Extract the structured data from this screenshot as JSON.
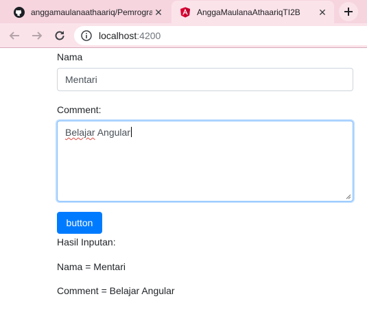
{
  "browser": {
    "tabs": [
      {
        "title": "anggamaulanaathaariq/Pemrogra",
        "icon": "github-icon",
        "active": false
      },
      {
        "title": "AnggaMaulanaAthaariqTI2B",
        "icon": "angular-icon",
        "active": true
      }
    ],
    "close_glyph": "✕",
    "new_tab_glyph": "+",
    "address": {
      "host": "localhost",
      "port": ":4200"
    },
    "colors": {
      "tab_strip": "#f6d5df",
      "toolbar": "#fbe3ea"
    }
  },
  "form": {
    "name_label": "Nama",
    "name_value": "Mentari",
    "comment_label": "Comment:",
    "comment_word1": "Belajar",
    "comment_word2": " Angular",
    "button_label": "button",
    "button_color": "#007bff"
  },
  "output": {
    "heading": "Hasil Inputan:",
    "name_line": "Nama = Mentari",
    "comment_line": "Comment = Belajar Angular"
  }
}
